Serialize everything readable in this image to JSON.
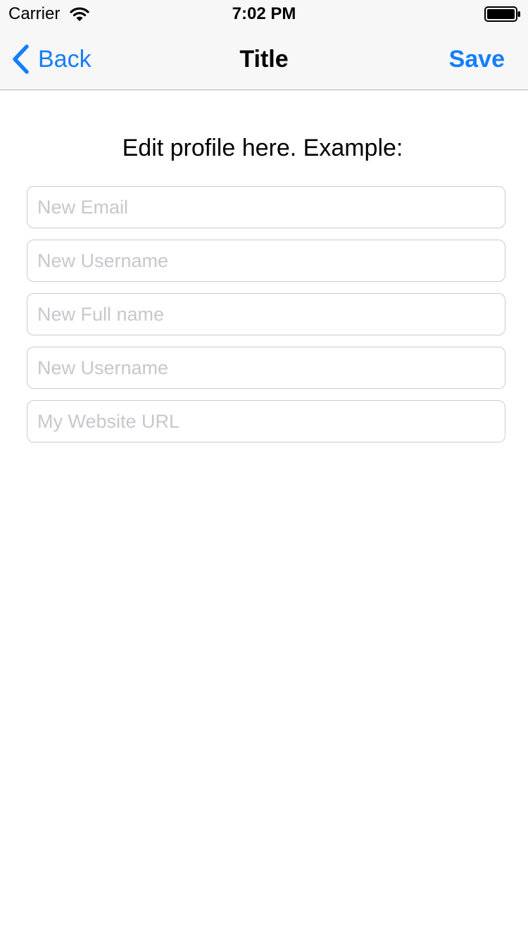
{
  "status_bar": {
    "carrier": "Carrier",
    "time": "7:02 PM",
    "wifi_icon": "wifi-icon",
    "battery_icon": "battery-icon"
  },
  "nav_bar": {
    "back_label": "Back",
    "title": "Title",
    "save_label": "Save",
    "accent_color": "#147efb"
  },
  "content": {
    "instruction": "Edit profile here. Example:",
    "fields": [
      {
        "value": "",
        "placeholder": "New Email"
      },
      {
        "value": "",
        "placeholder": "New Username"
      },
      {
        "value": "",
        "placeholder": "New Full name"
      },
      {
        "value": "",
        "placeholder": "New Username"
      },
      {
        "value": "",
        "placeholder": "My Website URL"
      }
    ]
  }
}
